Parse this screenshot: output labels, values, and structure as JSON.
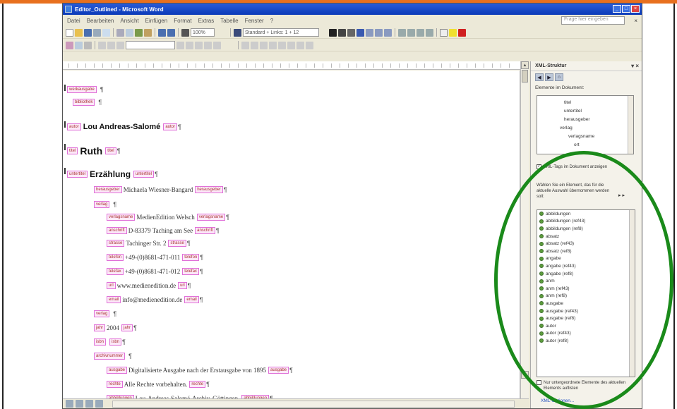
{
  "window": {
    "title": "Editor_Outlined - Microsoft Word"
  },
  "menu": [
    "Datei",
    "Bearbeiten",
    "Ansicht",
    "Einfügen",
    "Format",
    "Extras",
    "Tabelle",
    "Fenster",
    "?"
  ],
  "help_placeholder": "Frage hier eingeben",
  "toolbar": {
    "zoom": "100%",
    "style": "Standard + Links: 1 +  12"
  },
  "document": {
    "lines": [
      {
        "indent": 0,
        "open": "werkausgabe",
        "text": "",
        "close": ""
      },
      {
        "indent": 1,
        "open": "bibliothek",
        "text": "",
        "close": ""
      },
      {
        "indent": 0,
        "open": "autor",
        "text": "Lou Andreas-Salomé",
        "close": "autor",
        "style": "h3"
      },
      {
        "indent": 0,
        "open": "titel",
        "text": "Ruth",
        "close": "titel",
        "style": "h1"
      },
      {
        "indent": 0,
        "open": "untertitel",
        "text": "Erzählung",
        "close": "untertitel",
        "style": "h2"
      },
      {
        "indent": 2,
        "open": "herausgeber",
        "text": "Michaela Wiesner-Bangard",
        "close": "herausgeber"
      },
      {
        "indent": 2,
        "open": "verlag",
        "text": "",
        "close": ""
      },
      {
        "indent": 3,
        "open": "verlagsname",
        "text": "MedienEdition Welsch",
        "close": "verlagsname"
      },
      {
        "indent": 3,
        "open": "anschrift",
        "text": "D-83379 Taching am See",
        "close": "anschrift"
      },
      {
        "indent": 3,
        "open": "strasse",
        "text": "Tachinger Str. 2",
        "close": "strasse"
      },
      {
        "indent": 3,
        "open": "telefon",
        "text": "+49-(0)8681-471-011",
        "close": "telefon"
      },
      {
        "indent": 3,
        "open": "telefax",
        "text": "+49-(0)8681-471-012",
        "close": "telefax"
      },
      {
        "indent": 3,
        "open": "url",
        "text": "www.medienedition.de",
        "close": "url"
      },
      {
        "indent": 3,
        "open": "email",
        "text": "info@medienedition.de",
        "close": "email"
      },
      {
        "indent": 2,
        "open": "verlag",
        "text": "",
        "close": ""
      },
      {
        "indent": 2,
        "open": "jahr",
        "text": "2004",
        "close": "jahr"
      },
      {
        "indent": 2,
        "open": "isbn",
        "text": "",
        "close": "isbn"
      },
      {
        "indent": 2,
        "open": "archivnummer",
        "text": "",
        "close": ""
      },
      {
        "indent": 3,
        "open": "ausgabe",
        "text": "Digitalisierte Ausgabe nach der Erstausgabe von 1895",
        "close": "ausgabe"
      },
      {
        "indent": 3,
        "open": "rechte",
        "text": "Alle Rechte vorbehalten.",
        "close": "rechte"
      },
      {
        "indent": 3,
        "open": "abbildungen",
        "text": "Lou-Andreas-Salomé-Archiv, Göttingen.",
        "close": "abbildungen"
      }
    ]
  },
  "xml_pane": {
    "title": "XML-Struktur",
    "elements_label": "Elemente im Dokument:",
    "tree_items": [
      "titel",
      "untertitel",
      "herausgeber",
      "verlag",
      "verlagsname",
      "ort"
    ],
    "show_tags_label": "XML-Tags im Dokument anzeigen",
    "choose_label": "Wählen Sie ein Element, das für die aktuelle Auswahl übernommen werden soll:",
    "elements": [
      "abbildungen",
      "abbildungen (ref43)",
      "abbildungen (ref8)",
      "absatz",
      "absatz (ref43)",
      "absatz (ref8)",
      "angabe",
      "angabe (ref43)",
      "angabe (ref8)",
      "anm",
      "anm (ref43)",
      "anm (ref8)",
      "ausgabe",
      "ausgabe (ref43)",
      "ausgabe (ref8)",
      "autor",
      "autor (ref43)",
      "autor (ref8)"
    ],
    "only_children_label": "Nur untergeordnete Elemente des aktuellen Elements auflisten",
    "xml_options": "XML-Optionen..."
  },
  "colors": {
    "callout": "#1a8a1a",
    "tag_border": "#e070d8",
    "title_bar": "#0a3ab8"
  }
}
